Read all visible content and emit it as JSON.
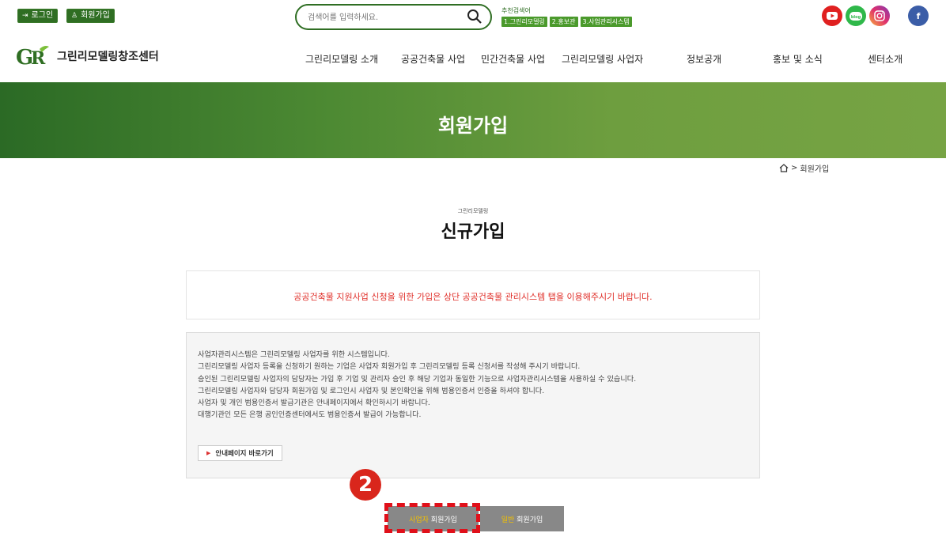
{
  "top": {
    "login": "로그인",
    "signup": "회원가입",
    "search_placeholder": "검색어를 입력하세요.",
    "rec_title": "추천검색어",
    "rec_tags": [
      "1.그린리모델링",
      "2.홍보관",
      "3.사업관리시스템"
    ],
    "sns": [
      "YouTube",
      "blog",
      "Instagram",
      "Facebook"
    ]
  },
  "nav": {
    "logo_mark": "GR",
    "logo_text": "그린리모델링창조센터",
    "menu": [
      "그린리모델링 소개",
      "공공건축물 사업",
      "민간건축물 사업",
      "그린리모델링 사업자",
      "정보공개",
      "홍보 및 소식",
      "센터소개"
    ]
  },
  "banner": {
    "title": "회원가입"
  },
  "breadcrumb": {
    "sep": ">",
    "current": "회원가입"
  },
  "section": {
    "small": "그린리모델링",
    "title": "신규가입"
  },
  "notice": "공공건축물 지원사업 신청을 위한 가입은 상단 공공건축물 관리시스템 탭을 이용해주시기 바랍니다.",
  "info": {
    "lines": [
      "사업자관리시스템은 그린리모델링 사업자를 위한 시스템입니다.",
      "그린리모델링 사업자 등록을 신청하기 원하는 기업은 사업자 회원가입 후 그린리모델링 등록 신청서를 작성해 주시기 바랍니다.",
      "승인된 그린리모델링 사업자의 담당자는 가입 후 기업 및 관리자 승인 후 해당 기업과 동일한 기능으로 사업자관리시스템을 사용하실 수 있습니다.",
      "그린리모델링 사업자와 담당자 회원가입 및 로그인시 사업자 및 본인확인을 위해 범용인증서 인증을 하셔야 합니다.",
      "사업자 및 개인 범용인증서 발급기관은 안내페이지에서 확인하시기 바랍니다.",
      "대행기관인 모든 은행 공인인증센터에서도 범용인증서 발급이 가능합니다."
    ],
    "guide_button": "안내페이지 바로가기"
  },
  "step_badge": "2",
  "buttons": {
    "biz_hl": "사업자",
    "biz_rest": " 회원가입",
    "gen_hl": "일반",
    "gen_rest": " 회원가입"
  },
  "colors": {
    "brand": "#2f6e23",
    "notice": "#e0302a",
    "highlight": "#d9261c"
  }
}
